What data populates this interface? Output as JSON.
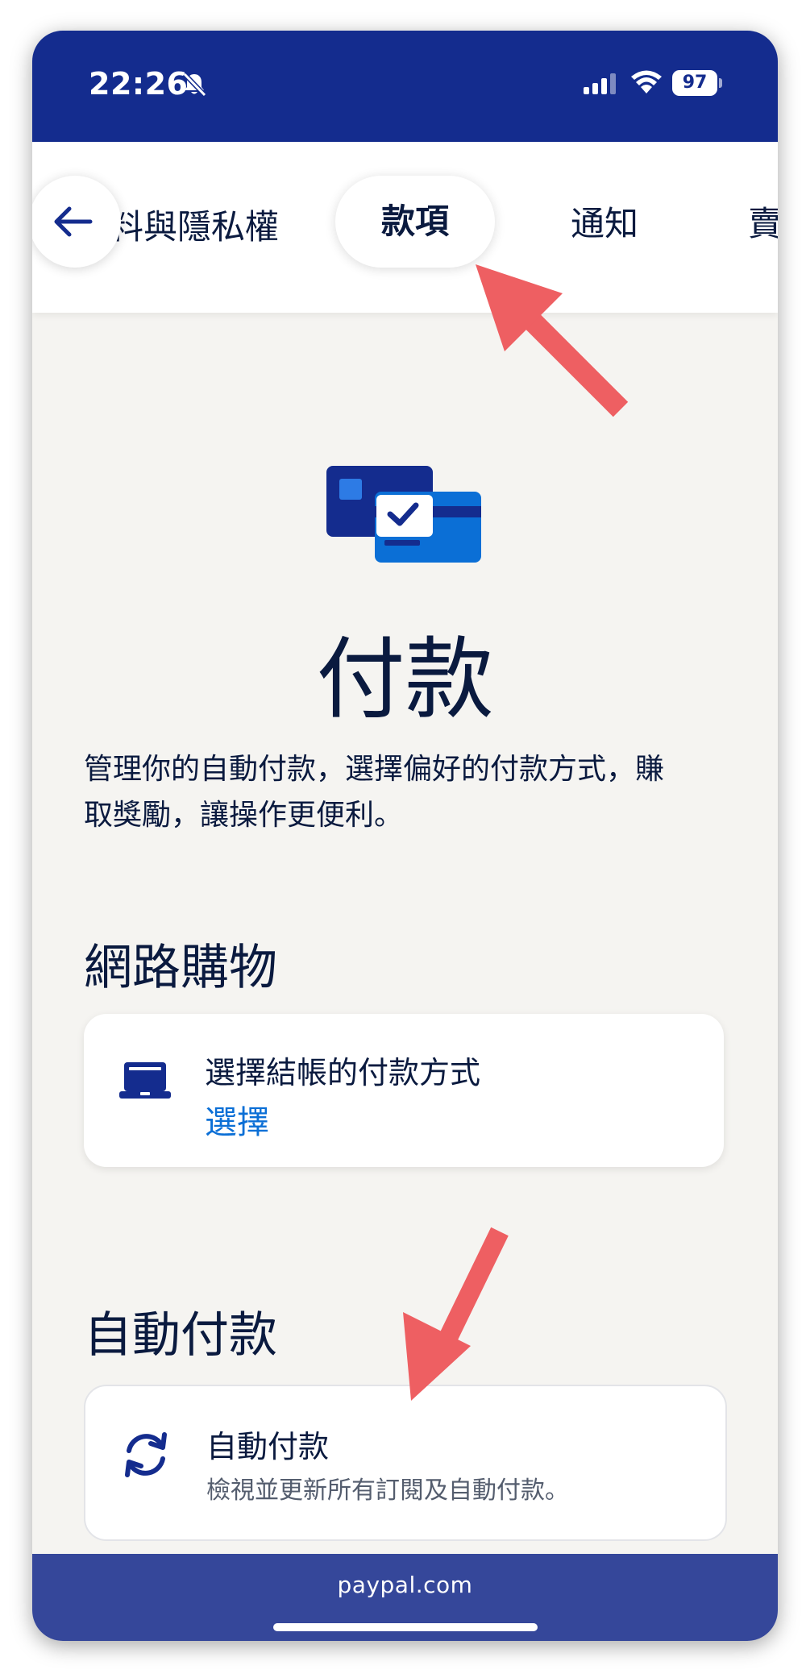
{
  "status_bar": {
    "time": "22:26",
    "battery": "97",
    "icons": [
      "bell-slash-icon",
      "signal-icon",
      "wifi-icon",
      "battery-icon"
    ]
  },
  "tabs": {
    "items": [
      {
        "label": "料與隱私權"
      },
      {
        "label": "款項",
        "selected": true
      },
      {
        "label": "通知"
      },
      {
        "label": "賣"
      }
    ],
    "back_icon": "arrow-left-icon"
  },
  "page": {
    "hero_icon": "payment-cards-icon",
    "title": "付款",
    "description": "管理你的自動付款，選擇偏好的付款方式，賺取獎勵，讓操作更便利。"
  },
  "sections": {
    "online_shopping": {
      "title": "網路購物",
      "card": {
        "icon": "laptop-icon",
        "title": "選擇結帳的付款方式",
        "action": "選擇"
      }
    },
    "auto_pay": {
      "title": "自動付款",
      "card": {
        "icon": "refresh-icon",
        "title": "自動付款",
        "subtitle": "檢視並更新所有訂閱及自動付款。"
      }
    }
  },
  "footer": {
    "url": "paypal.com"
  },
  "colors": {
    "brand_navy": "#142c8e",
    "url_bar": "#35479a",
    "background": "#f5f4f1",
    "link": "#0b6fd6",
    "annotation_arrow": "#ee5f62"
  }
}
